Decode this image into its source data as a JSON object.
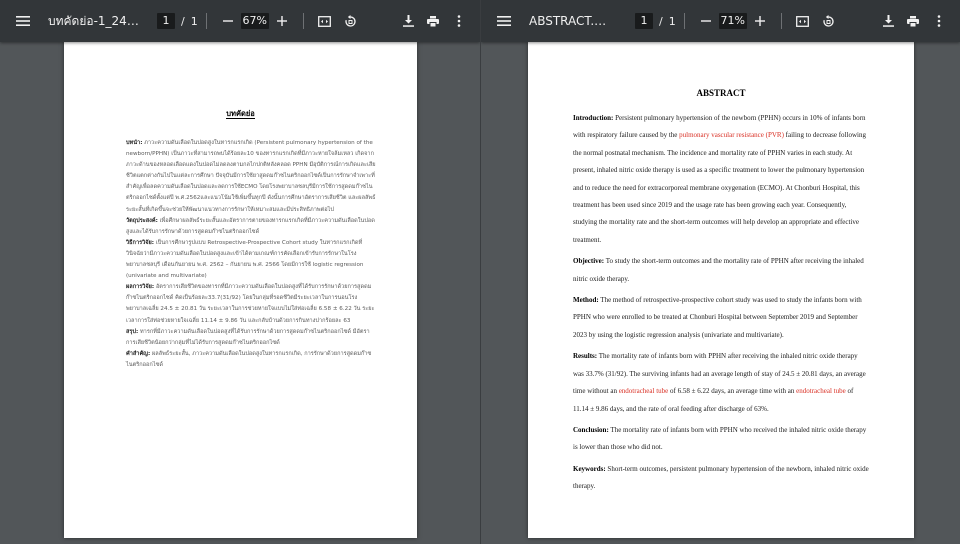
{
  "left_viewer": {
    "title": "บทคัดย่อ-1_240218_1...",
    "page_current": "1",
    "page_sep": "/",
    "page_total": "1",
    "zoom": "67%",
    "document": {
      "heading": "บทคัดย่อ",
      "paragraphs": [
        {
          "label": "บทนำ:",
          "text": " ภาวะความดันเลือดในปอดสูงในทารกแรกเกิด (Persistent pulmonary hypertension of the newborn/PPHN) เป็นภาวะที่สามารถพบได้ร้อยละ10 ของทารกแรกเกิดที่มีภาวะหายใจล้มเหลว เกิดจากภาวะด้านของหลอดเลือดแดงในปอดไม่ลดลงตามกลไกปกติหลังคลอด PPHN มีอุบัติการณ์การเกิดและเสียชีวิตแตกต่างกันไปในแต่ละการศึกษา ปัจจุบันมีการใช้ยาสูดดมก๊าซไนตริกออกไซด์เป็นการรักษาจำเพาะที่สำคัญเพื่อลดความดันเลือดในปอดและลดการใช้ECMO โดยโรงพยาบาลชลบุรีมีการใช้การสูดดมก๊าซไนตริกออกไซด์ตั้งแต่ปี พ.ศ.2562และแนวโน้มใช้เพิ่มขึ้นทุกปี ดังนั้นการศึกษาอัตราการเสียชีวิต และผลลัพธ์ระยะสั้นที่เกิดขึ้นจะช่วยให้พัฒนาแนวทางการรักษาให้เหมาะสมและมีประสิทธิภาพต่อไป"
        },
        {
          "label": "วัตถุประสงค์:",
          "text": " เพื่อศึกษาผลลัพธ์ระยะสั้นและอัตราการตายของทารกแรกเกิดที่มีภาวะความดันเลือดในปอดสูงและได้รับการรักษาด้วยการสูดดมก๊าซไนตริกออกไซด์"
        },
        {
          "label": "วิธีการวิจัย:",
          "text": " เป็นการศึกษารูปแบบ Retrospective-Prospective Cohort study ในทารกแรกเกิดที่วินิจฉัยว่ามีภาวะความดันเลือดในปอดสูงและเข้าได้ตามเกณฑ์การคัดเลือกเข้ารับการรักษาในโรงพยาบาลชลบุรี เดือนกันยายน พ.ศ. 2562 – กันยายน พ.ศ. 2566 โดยมีการใช้ logistic regression (univariate and multivariate)"
        },
        {
          "label": "ผลการวิจัย:",
          "text": " อัตราการเสียชีวิตของทารกที่มีภาวะความดันเลือดในปอดสูงที่ได้รับการรักษาด้วยการสูดดมก๊าซไนตริกออกไซด์ คิดเป็นร้อยละ33.7(31/92) โดยในกลุ่มที่รอดชีวิตมีระยะเวลาในการนอนโรงพยาบาลเฉลี่ย 24.5 ± 20.81 วัน ระยะเวลาในการช่วยหายใจแบบไม่ใส่ท่อเฉลี่ย 6.58 ± 6.22 วัน ระยะเวลาการใส่ท่อช่วยหายใจเฉลี่ย 11.14 ± 9.86 วัน และกลับบ้านด้วยการกินทางปากร้อยละ 63"
        },
        {
          "label": "สรุป:",
          "text": " ทารกที่มีภาวะความดันเลือดในปอดสูงที่ได้รับการรักษาด้วยการสูดดมก๊าซไนตริกออกไซด์ มีอัตราการเสียชีวิตน้อยกว่ากลุ่มที่ไม่ได้รับการสูดดมก๊าซไนตริกออกไซด์"
        },
        {
          "label": "คำสำคัญ:",
          "text": " ผลลัพธ์ระยะสั้น, ภาวะความดันเลือดในปอดสูงในทารกแรกเกิด, การรักษาด้วยการสูดดมก๊าซไนตริกออกไซด์"
        }
      ]
    }
  },
  "right_viewer": {
    "title": "ABSTRACT.pdf",
    "page_current": "1",
    "page_sep": "/",
    "page_total": "1",
    "zoom": "71%",
    "document": {
      "heading": "ABSTRACT",
      "intro": {
        "label": "Introduction:",
        "t1": " Persistent pulmonary hypertension of the newborn (PPHN) occurs in 10% of infants born with respiratory failure caused by the ",
        "h1": "pulmonary vascular resistance (PVR)",
        "t2": " failing to decrease following the normal postnatal mechanism. The incidence and mortality rate of PPHN varies in each study. At present, inhaled nitric oxide therapy is used as a specific treatment to lower the pulmonary hypertension and to reduce the need for extracorporeal membrane oxygenation (ECMO). At Chonburi Hospital, this treatment has been used since 2019 and the usage rate has been growing each year. Consequently, studying the mortality rate and the short-term outcomes will help develop an appropriate and effective treatment."
      },
      "objective": {
        "label": "Objective:",
        "text": " To study the short-term outcomes and the mortality rate of PPHN after receiving the inhaled nitric oxide therapy."
      },
      "method": {
        "label": "Method:",
        "text": " The method of retrospective-prospective cohort study was used to study the infants born with PPHN who were enrolled to be treated at Chonburi Hospital between September 2019 and September 2023 by using the logistic regression analysis (univariate and multivariate)."
      },
      "results": {
        "label": "Results:",
        "t1": " The mortality rate of infants born with PPHN after receiving the inhaled nitric oxide therapy was 33.7% (31/92). The surviving infants had an average length of stay of 24.5 ± 20.81 days, an average time without an ",
        "h1": "endotracheal tube",
        "t2": " of 6.58 ± 6.22 days, an average time with an ",
        "h2": "endotracheal tube",
        "t3": " of 11.14 ± 9.86 days, and the rate of oral feeding after discharge of 63%."
      },
      "conclusion": {
        "label": "Conclusion:",
        "text": " The mortality rate of infants born with PPHN who received the inhaled nitric oxide therapy is lower than those who did not."
      },
      "keywords": {
        "label": "Keywords:",
        "text": " Short-term outcomes, persistent pulmonary hypertension of the newborn, inhaled nitric oxide therapy."
      }
    }
  },
  "icons": [
    "menu-icon",
    "minus-icon",
    "plus-icon",
    "fit-page-icon",
    "rotate-icon",
    "download-icon",
    "print-icon",
    "more-vert-icon"
  ],
  "colors": {
    "toolbar": "#323639",
    "viewer_bg": "#525659",
    "highlight": "#d93025"
  }
}
